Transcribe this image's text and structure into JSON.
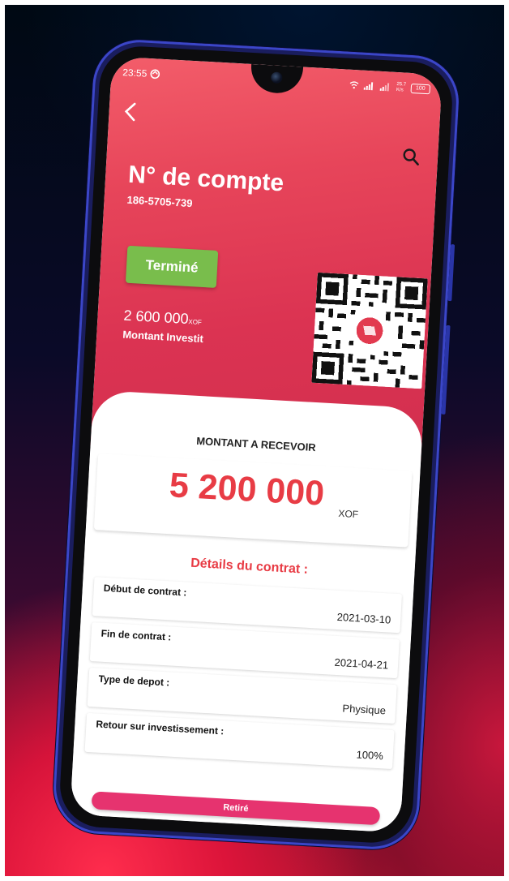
{
  "status_bar": {
    "time": "23:55",
    "speed": "25.7",
    "speed_unit": "K/s",
    "battery": "100"
  },
  "header": {
    "title": "N° de compte",
    "account_number": "186-5705-739",
    "back_icon": "arrow-back-icon",
    "search_icon": "search-icon"
  },
  "summary": {
    "status": "Terminé",
    "status_color": "#79bd4c",
    "invested_amount": "2 600 000",
    "invested_unit": "XOF",
    "invested_label": "Montant Investit"
  },
  "receive": {
    "label": "MONTANT A RECEVOIR",
    "amount": "5 200 000",
    "unit": "XOF"
  },
  "details": {
    "title": "Détails du contrat :",
    "rows": [
      {
        "label": "Début de contrat :",
        "value": "2021-03-10"
      },
      {
        "label": "Fin de contrat :",
        "value": "2021-04-21"
      },
      {
        "label": "Type de depot :",
        "value": "Physique"
      },
      {
        "label": "Retour sur investissement :",
        "value": "100%"
      }
    ]
  },
  "actions": {
    "withdraw_label": "Retiré",
    "withdraw_color": "#e6336f"
  },
  "colors": {
    "hero": "#e03b55",
    "accent_red": "#e83c45",
    "phone_frame": "#1a1d5e"
  }
}
